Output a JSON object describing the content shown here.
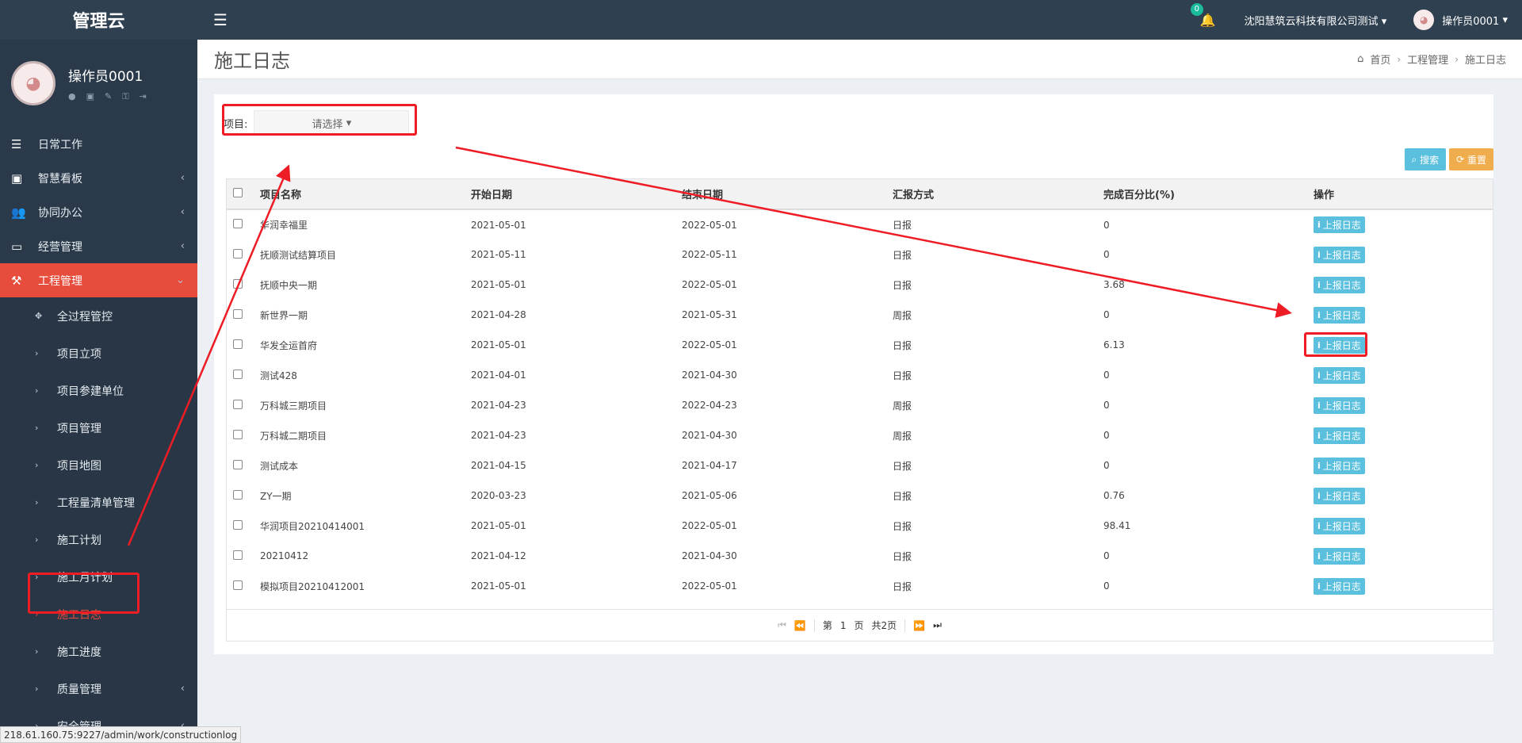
{
  "app_title": "管理云",
  "user": {
    "name": "操作员0001"
  },
  "sidebar": {
    "items": [
      {
        "label": "日常工作",
        "icon": "list-icon",
        "glyph": "☰",
        "has_children": false
      },
      {
        "label": "智慧看板",
        "icon": "dashboard-icon",
        "glyph": "▣",
        "has_children": true
      },
      {
        "label": "协同办公",
        "icon": "users-icon",
        "glyph": "👥",
        "has_children": true
      },
      {
        "label": "经营管理",
        "icon": "desktop-icon",
        "glyph": "▭",
        "has_children": true
      },
      {
        "label": "工程管理",
        "icon": "gavel-icon",
        "glyph": "⚒",
        "has_children": true,
        "expanded": true
      }
    ],
    "sub_items": [
      {
        "label": "全过程管控",
        "glyph": "✥"
      },
      {
        "label": "项目立项",
        "glyph": "›"
      },
      {
        "label": "项目参建单位",
        "glyph": "›"
      },
      {
        "label": "项目管理",
        "glyph": "›"
      },
      {
        "label": "项目地图",
        "glyph": "›"
      },
      {
        "label": "工程量清单管理",
        "glyph": "›"
      },
      {
        "label": "施工计划",
        "glyph": "›"
      },
      {
        "label": "施工月计划",
        "glyph": "›"
      },
      {
        "label": "施工日志",
        "glyph": "›",
        "active": true
      },
      {
        "label": "施工进度",
        "glyph": "›"
      },
      {
        "label": "质量管理",
        "glyph": "›",
        "has_children": true
      },
      {
        "label": "安全管理",
        "glyph": "›",
        "has_children": true
      }
    ]
  },
  "topbar": {
    "notification_count": "0",
    "company": "沈阳慧筑云科技有限公司测试",
    "user_name": "操作员0001"
  },
  "page": {
    "title": "施工日志",
    "breadcrumb": [
      "首页",
      "工程管理",
      "施工日志"
    ]
  },
  "filter": {
    "label": "项目:",
    "placeholder": "请选择"
  },
  "buttons": {
    "search": "搜索",
    "reset": "重置"
  },
  "table": {
    "headers": [
      "项目名称",
      "开始日期",
      "结束日期",
      "汇报方式",
      "完成百分比(%)",
      "操作"
    ],
    "action_label": "上报日志",
    "rows": [
      [
        "华润幸福里",
        "2021-05-01",
        "2022-05-01",
        "日报",
        "0"
      ],
      [
        "抚顺测试结算项目",
        "2021-05-11",
        "2022-05-11",
        "日报",
        "0"
      ],
      [
        "抚顺中央一期",
        "2021-05-01",
        "2022-05-01",
        "日报",
        "3.68"
      ],
      [
        "新世界一期",
        "2021-04-28",
        "2021-05-31",
        "周报",
        "0"
      ],
      [
        "华发全运首府",
        "2021-05-01",
        "2022-05-01",
        "日报",
        "6.13"
      ],
      [
        "测试428",
        "2021-04-01",
        "2021-04-30",
        "日报",
        "0"
      ],
      [
        "万科城三期项目",
        "2021-04-23",
        "2022-04-23",
        "周报",
        "0"
      ],
      [
        "万科城二期项目",
        "2021-04-23",
        "2021-04-30",
        "周报",
        "0"
      ],
      [
        "测试成本",
        "2021-04-15",
        "2021-04-17",
        "日报",
        "0"
      ],
      [
        "ZY一期",
        "2020-03-23",
        "2021-05-06",
        "日报",
        "0.76"
      ],
      [
        "华润项目20210414001",
        "2021-05-01",
        "2022-05-01",
        "日报",
        "98.41"
      ],
      [
        "20210412",
        "2021-04-12",
        "2021-04-30",
        "日报",
        "0"
      ],
      [
        "模拟项目20210412001",
        "2021-05-01",
        "2022-05-01",
        "日报",
        "0"
      ]
    ]
  },
  "pager": {
    "page_prefix": "第",
    "page_num": "1",
    "page_suffix": "页",
    "total": "共2页"
  },
  "status_url": "218.61.160.75:9227/admin/work/constructionlog",
  "colors": {
    "accent_red": "#e74c3c",
    "info": "#5bc0de",
    "warning": "#f0ad4e",
    "annotation": "#ee1c25"
  }
}
